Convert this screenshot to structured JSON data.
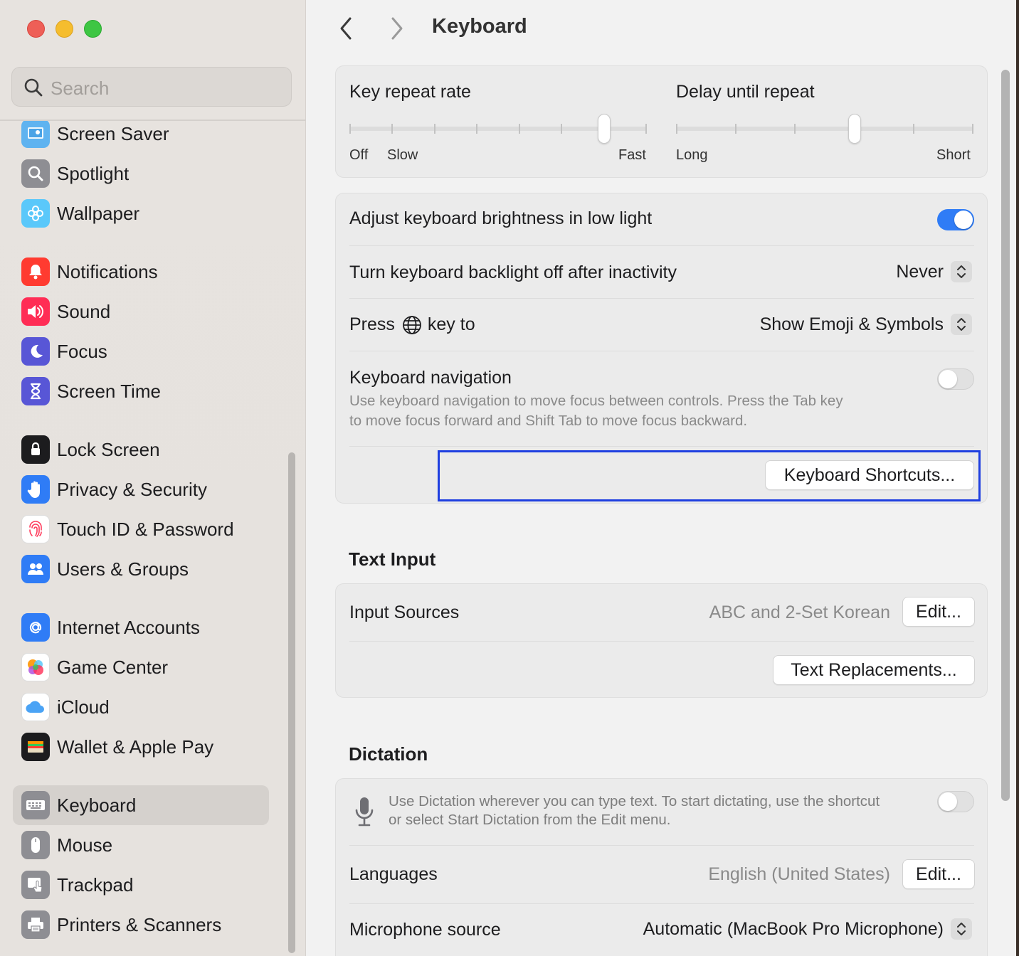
{
  "window": {
    "title": "Keyboard"
  },
  "sidebar": {
    "search_placeholder": "Search",
    "items": [
      {
        "label": "Screen Saver",
        "icon": "screen-saver-icon",
        "color": "#5fb3f0",
        "selected": false
      },
      {
        "label": "Spotlight",
        "icon": "spotlight-icon",
        "color": "#8e8e93",
        "selected": false
      },
      {
        "label": "Wallpaper",
        "icon": "wallpaper-icon",
        "color": "#5ac8fa",
        "selected": false
      },
      {
        "label": "Notifications",
        "icon": "notifications-icon",
        "color": "#ff3b30",
        "selected": false
      },
      {
        "label": "Sound",
        "icon": "sound-icon",
        "color": "#ff2d55",
        "selected": false
      },
      {
        "label": "Focus",
        "icon": "focus-icon",
        "color": "#5856d6",
        "selected": false
      },
      {
        "label": "Screen Time",
        "icon": "screen-time-icon",
        "color": "#5856d6",
        "selected": false
      },
      {
        "label": "Lock Screen",
        "icon": "lock-screen-icon",
        "color": "#1c1c1e",
        "selected": false
      },
      {
        "label": "Privacy & Security",
        "icon": "privacy-hand-icon",
        "color": "#2f7cf6",
        "selected": false
      },
      {
        "label": "Touch ID & Password",
        "icon": "fingerprint-icon",
        "color": "#ffffff",
        "selected": false
      },
      {
        "label": "Users & Groups",
        "icon": "users-icon",
        "color": "#2f7cf6",
        "selected": false
      },
      {
        "label": "Internet Accounts",
        "icon": "at-sign-icon",
        "color": "#2f7cf6",
        "selected": false
      },
      {
        "label": "Game Center",
        "icon": "game-center-icon",
        "color": "#ffffff",
        "selected": false
      },
      {
        "label": "iCloud",
        "icon": "icloud-icon",
        "color": "#ffffff",
        "selected": false
      },
      {
        "label": "Wallet & Apple Pay",
        "icon": "wallet-icon",
        "color": "#1c1c1e",
        "selected": false
      },
      {
        "label": "Keyboard",
        "icon": "keyboard-icon",
        "color": "#8e8e93",
        "selected": true
      },
      {
        "label": "Mouse",
        "icon": "mouse-icon",
        "color": "#8e8e93",
        "selected": false
      },
      {
        "label": "Trackpad",
        "icon": "trackpad-icon",
        "color": "#8e8e93",
        "selected": false
      },
      {
        "label": "Printers & Scanners",
        "icon": "printer-icon",
        "color": "#8e8e93",
        "selected": false
      }
    ]
  },
  "repeat": {
    "key_repeat_label": "Key repeat rate",
    "key_repeat_min": "Off",
    "key_repeat_slow": "Slow",
    "key_repeat_max": "Fast",
    "key_repeat_stop": 6,
    "key_repeat_stops": 8,
    "delay_label": "Delay until repeat",
    "delay_min": "Long",
    "delay_max": "Short",
    "delay_stop": 3,
    "delay_stops": 6
  },
  "keyboard": {
    "brightness_label": "Adjust keyboard brightness in low light",
    "brightness_on": true,
    "backlight_label": "Turn keyboard backlight off after inactivity",
    "backlight_value": "Never",
    "press_prefix": "Press",
    "press_suffix": "key to",
    "press_value": "Show Emoji & Symbols",
    "nav_label": "Keyboard navigation",
    "nav_desc_line1": "Use keyboard navigation to move focus between controls. Press the Tab key",
    "nav_desc_line2": "to move focus forward and Shift Tab to move focus backward.",
    "nav_on": false,
    "shortcuts_button": "Keyboard Shortcuts..."
  },
  "text_input": {
    "section_title": "Text Input",
    "input_sources_label": "Input Sources",
    "input_sources_value": "ABC and 2-Set Korean",
    "edit_button": "Edit...",
    "text_replacements_button": "Text Replacements..."
  },
  "dictation": {
    "section_title": "Dictation",
    "desc_line1": "Use Dictation wherever you can type text. To start dictating, use the shortcut",
    "desc_line2": "or select Start Dictation from the Edit menu.",
    "dictation_on": false,
    "languages_label": "Languages",
    "languages_value": "English (United States)",
    "edit_button": "Edit...",
    "mic_label": "Microphone source",
    "mic_value": "Automatic (MacBook Pro Microphone)"
  },
  "colors": {
    "accent": "#2f7cf6",
    "focus_ring": "#1f3fe0"
  }
}
